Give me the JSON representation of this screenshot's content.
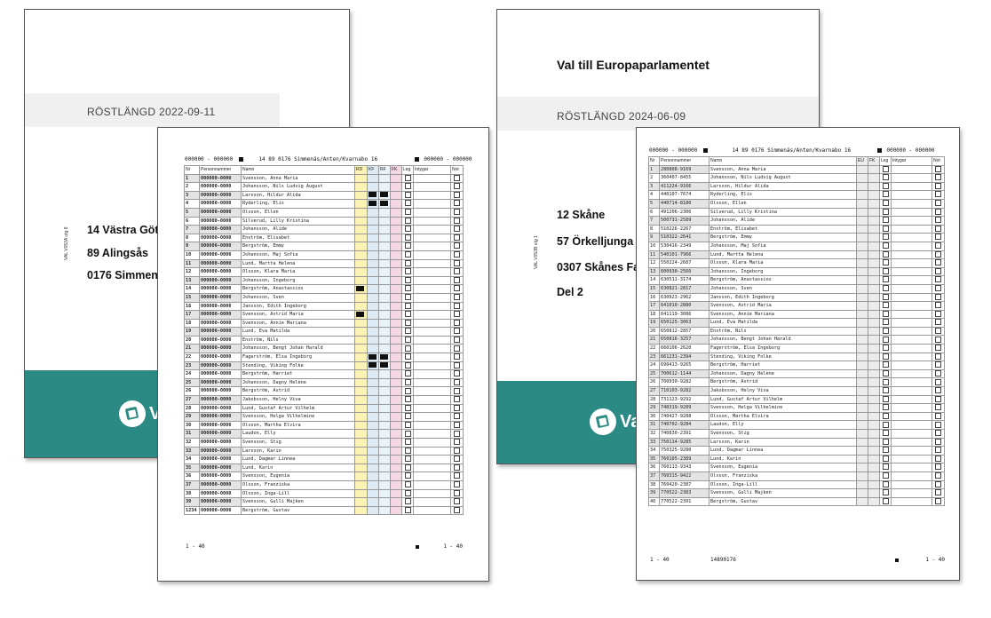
{
  "cover_left": {
    "heading": "RÖSTLÄNGD  2022-09-11",
    "side_form": "VAL V053A utg 8",
    "lines": [
      "14 Västra Göt",
      "89 Alingsås",
      "0176 Simmen"
    ],
    "logo_text": "Va"
  },
  "cover_right": {
    "title": "Val till Europaparlamentet",
    "heading": "RÖSTLÄNGD  2024-06-09",
    "side_form": "VAL V053B utg 1",
    "lines": [
      "12 Skåne",
      "57 Örkelljunga",
      "0307 Skånes Fa",
      "Del 2"
    ],
    "logo_text": "Val"
  },
  "sheet_left": {
    "header_left": "000000 - 000000",
    "header_mid": "14  89  0176  Simmenäs/Anten/Kvarnabo 16",
    "header_right": "000000 - 000000",
    "columns": [
      "Nr",
      "Personnummer",
      "Namn",
      "RD",
      "KF",
      "RF",
      "FK",
      "Leg",
      "Intygar",
      "Not"
    ],
    "rows": [
      {
        "nr": "1",
        "pnr": "000000-0000",
        "name": "Svensson, Anna Maria",
        "kf": false,
        "rf": false,
        "rd": false
      },
      {
        "nr": "2",
        "pnr": "000000-0000",
        "name": "Johansson, Nils Ludvig August",
        "kf": false,
        "rf": false,
        "rd": false
      },
      {
        "nr": "3",
        "pnr": "000000-0000",
        "name": "Larsson, Hildur Alida",
        "kf": true,
        "rf": true,
        "rd": false
      },
      {
        "nr": "4",
        "pnr": "000000-0000",
        "name": "Ryderling, Elis",
        "kf": true,
        "rf": true,
        "rd": false
      },
      {
        "nr": "5",
        "pnr": "000000-0000",
        "name": "Olsson, Ellen",
        "kf": false,
        "rf": false,
        "rd": false
      },
      {
        "nr": "6",
        "pnr": "000000-0000",
        "name": "Silverud, Lilly Kristina",
        "kf": false,
        "rf": false,
        "rd": false
      },
      {
        "nr": "7",
        "pnr": "000000-0000",
        "name": "Johansson, Alide",
        "kf": false,
        "rf": false,
        "rd": false
      },
      {
        "nr": "8",
        "pnr": "000000-0000",
        "name": "Enström, Elisabet",
        "kf": false,
        "rf": false,
        "rd": false
      },
      {
        "nr": "9",
        "pnr": "000000-0000",
        "name": "Bergström, Emmy",
        "kf": false,
        "rf": false,
        "rd": false
      },
      {
        "nr": "10",
        "pnr": "000000-0000",
        "name": "Johansson, Maj Sofia",
        "kf": false,
        "rf": false,
        "rd": false
      },
      {
        "nr": "11",
        "pnr": "000000-0000",
        "name": "Lund, Martta Helena",
        "kf": false,
        "rf": false,
        "rd": false
      },
      {
        "nr": "12",
        "pnr": "000000-0000",
        "name": "Olsson, Klara Maria",
        "kf": false,
        "rf": false,
        "rd": false
      },
      {
        "nr": "13",
        "pnr": "000000-0000",
        "name": "Johansson, Ingeborg",
        "kf": false,
        "rf": false,
        "rd": false
      },
      {
        "nr": "14",
        "pnr": "000000-0000",
        "name": "Bergström, Anastassios",
        "kf": false,
        "rf": false,
        "rd": true
      },
      {
        "nr": "15",
        "pnr": "000000-0000",
        "name": "Johansson, Sven",
        "kf": false,
        "rf": false,
        "rd": false
      },
      {
        "nr": "16",
        "pnr": "000000-0000",
        "name": "Jansson, Edith Ingeborg",
        "kf": false,
        "rf": false,
        "rd": false
      },
      {
        "nr": "17",
        "pnr": "000000-0000",
        "name": "Svensson, Astrid Maria",
        "kf": false,
        "rf": false,
        "rd": true
      },
      {
        "nr": "18",
        "pnr": "000000-0000",
        "name": "Svensson, Annie Mariana",
        "kf": false,
        "rf": false,
        "rd": false
      },
      {
        "nr": "19",
        "pnr": "000000-0000",
        "name": "Lund, Eva Matilda",
        "kf": false,
        "rf": false,
        "rd": false
      },
      {
        "nr": "20",
        "pnr": "000000-0000",
        "name": "Enström, Nils",
        "kf": false,
        "rf": false,
        "rd": false
      },
      {
        "nr": "21",
        "pnr": "000000-0000",
        "name": "Johansson, Bengt Johan Harald",
        "kf": false,
        "rf": false,
        "rd": false
      },
      {
        "nr": "22",
        "pnr": "000000-0000",
        "name": "Fagerström, Elsa Ingeborg",
        "kf": true,
        "rf": true,
        "rd": false
      },
      {
        "nr": "23",
        "pnr": "000000-0000",
        "name": "Stending, Viking Folke",
        "kf": true,
        "rf": true,
        "rd": false
      },
      {
        "nr": "24",
        "pnr": "000000-0000",
        "name": "Bergström, Harriet",
        "kf": false,
        "rf": false,
        "rd": false
      },
      {
        "nr": "25",
        "pnr": "000000-0000",
        "name": "Johansson, Dagny Helène",
        "kf": false,
        "rf": false,
        "rd": false
      },
      {
        "nr": "26",
        "pnr": "000000-0000",
        "name": "Bergström, Astrid",
        "kf": false,
        "rf": false,
        "rd": false
      },
      {
        "nr": "27",
        "pnr": "000000-0000",
        "name": "Jakobsson, Helny Viva",
        "kf": false,
        "rf": false,
        "rd": false
      },
      {
        "nr": "28",
        "pnr": "000000-0000",
        "name": "Lund, Gustaf Artur Vilhelm",
        "kf": false,
        "rf": false,
        "rd": false
      },
      {
        "nr": "29",
        "pnr": "000000-0000",
        "name": "Svensson, Helga Vilhelmine",
        "kf": false,
        "rf": false,
        "rd": false
      },
      {
        "nr": "30",
        "pnr": "000000-0000",
        "name": "Olsson, Martha Elvira",
        "kf": false,
        "rf": false,
        "rd": false
      },
      {
        "nr": "31",
        "pnr": "000000-0000",
        "name": "Laudon, Elly",
        "kf": false,
        "rf": false,
        "rd": false
      },
      {
        "nr": "32",
        "pnr": "000000-0000",
        "name": "Svensson, Stig",
        "kf": false,
        "rf": false,
        "rd": false
      },
      {
        "nr": "33",
        "pnr": "000000-0000",
        "name": "Larsson, Karin",
        "kf": false,
        "rf": false,
        "rd": false
      },
      {
        "nr": "34",
        "pnr": "000000-0000",
        "name": "Lund, Dagmar Linnea",
        "kf": false,
        "rf": false,
        "rd": false
      },
      {
        "nr": "35",
        "pnr": "000000-0000",
        "name": "Lund, Karin",
        "kf": false,
        "rf": false,
        "rd": false
      },
      {
        "nr": "36",
        "pnr": "000000-0000",
        "name": "Svensson, Eugenia",
        "kf": false,
        "rf": false,
        "rd": false
      },
      {
        "nr": "37",
        "pnr": "000000-0000",
        "name": "Olsson, Franziska",
        "kf": false,
        "rf": false,
        "rd": false
      },
      {
        "nr": "38",
        "pnr": "000000-0000",
        "name": "Olsson, Inga-Lill",
        "kf": false,
        "rf": false,
        "rd": false
      },
      {
        "nr": "39",
        "pnr": "000000-0000",
        "name": "Svensson, Gulli Majken",
        "kf": false,
        "rf": false,
        "rd": false
      },
      {
        "nr": "1234",
        "pnr": "000000-0000",
        "name": "Bergström, Gustav",
        "kf": false,
        "rf": false,
        "rd": false
      }
    ],
    "footer_left": "1 - 40",
    "footer_right": "1 - 40"
  },
  "sheet_right": {
    "header_left": "000000 - 000000",
    "header_mid": "14  89  0176  Simmenäs/Anten/Kvarnabo 16",
    "header_right": "000000 - 000000",
    "columns": [
      "Nr",
      "Personnummer",
      "Namn",
      "EU",
      "FK",
      "Leg",
      "Intygar",
      "Not"
    ],
    "rows": [
      {
        "nr": "1",
        "pnr": "280808-9169",
        "name": "Svensson, Anna Maria"
      },
      {
        "nr": "2",
        "pnr": "360407-8455",
        "name": "Johansson, Nils Ludvig August"
      },
      {
        "nr": "3",
        "pnr": "411224-9166",
        "name": "Larsson, Hildur Alida"
      },
      {
        "nr": "4",
        "pnr": "440107-7674",
        "name": "Ryderling, Elis"
      },
      {
        "nr": "5",
        "pnr": "440714-8180",
        "name": "Olsson, Ellen"
      },
      {
        "nr": "6",
        "pnr": "491206-2306",
        "name": "Silverud, Lilly Kristina"
      },
      {
        "nr": "7",
        "pnr": "500731-2589",
        "name": "Johansson, Alide"
      },
      {
        "nr": "8",
        "pnr": "510226-2267",
        "name": "Enström, Elisabet"
      },
      {
        "nr": "9",
        "pnr": "510322-2641",
        "name": "Bergström, Emmy"
      },
      {
        "nr": "10",
        "pnr": "530416-2349",
        "name": "Johansson, Maj Sofia"
      },
      {
        "nr": "11",
        "pnr": "540101-7966",
        "name": "Lund, Martta Helena"
      },
      {
        "nr": "12",
        "pnr": "550224-2687",
        "name": "Olsson, Klara Maria"
      },
      {
        "nr": "13",
        "pnr": "600930-2560",
        "name": "Johansson, Ingeborg"
      },
      {
        "nr": "14",
        "pnr": "630511-3174",
        "name": "Bergström, Anastassios"
      },
      {
        "nr": "15",
        "pnr": "630821-2817",
        "name": "Johansson, Sven"
      },
      {
        "nr": "16",
        "pnr": "630923-2962",
        "name": "Jansson, Edith Ingeborg"
      },
      {
        "nr": "17",
        "pnr": "641010-2880",
        "name": "Svensson, Astrid Maria"
      },
      {
        "nr": "18",
        "pnr": "641119-3086",
        "name": "Svensson, Annie Mariana"
      },
      {
        "nr": "19",
        "pnr": "650125-3063",
        "name": "Lund, Eva Matilda"
      },
      {
        "nr": "20",
        "pnr": "650812-2857",
        "name": "Enström, Nils"
      },
      {
        "nr": "21",
        "pnr": "650816-3257",
        "name": "Johansson, Bengt Johan Harald"
      },
      {
        "nr": "22",
        "pnr": "660106-2620",
        "name": "Fagerström, Elsa Ingeborg"
      },
      {
        "nr": "23",
        "pnr": "661231-2394",
        "name": "Stending, Viking Folke"
      },
      {
        "nr": "24",
        "pnr": "690413-9265",
        "name": "Bergström, Harriet"
      },
      {
        "nr": "25",
        "pnr": "700612-1144",
        "name": "Johansson, Dagny Helène"
      },
      {
        "nr": "26",
        "pnr": "700930-9282",
        "name": "Bergström, Astrid"
      },
      {
        "nr": "27",
        "pnr": "710103-9282",
        "name": "Jakobsson, Helny Viva"
      },
      {
        "nr": "28",
        "pnr": "731123-9292",
        "name": "Lund, Gustaf Artur Vilhelm"
      },
      {
        "nr": "29",
        "pnr": "740319-9289",
        "name": "Svensson, Helga Vilhelmine"
      },
      {
        "nr": "30",
        "pnr": "740427-9288",
        "name": "Olsson, Martha Elvira"
      },
      {
        "nr": "31",
        "pnr": "740702-9284",
        "name": "Laudon, Elly"
      },
      {
        "nr": "32",
        "pnr": "740830-2391",
        "name": "Svensson, Stig"
      },
      {
        "nr": "33",
        "pnr": "750114-9285",
        "name": "Larsson, Karin"
      },
      {
        "nr": "34",
        "pnr": "750325-9280",
        "name": "Lund, Dagmar Linnea"
      },
      {
        "nr": "35",
        "pnr": "760105-2389",
        "name": "Lund, Karin"
      },
      {
        "nr": "36",
        "pnr": "760113-9343",
        "name": "Svensson, Eugenia"
      },
      {
        "nr": "37",
        "pnr": "760315-9422",
        "name": "Olsson, Franziska"
      },
      {
        "nr": "38",
        "pnr": "760420-2387",
        "name": "Olsson, Inga-Lill"
      },
      {
        "nr": "39",
        "pnr": "770522-2383",
        "name": "Svensson, Gulli Majken"
      },
      {
        "nr": "40",
        "pnr": "770522-2391",
        "name": "Bergström, Gustav"
      }
    ],
    "footer_left": "1 - 40",
    "footer_mid": "14890176",
    "footer_right": "1 - 40"
  },
  "colors": {
    "footer_teal": "#2b8a84",
    "rd_yellow": "#fbf3b5",
    "kf_blue": "#dcebf6",
    "fk_pink": "#f5d6e4"
  }
}
